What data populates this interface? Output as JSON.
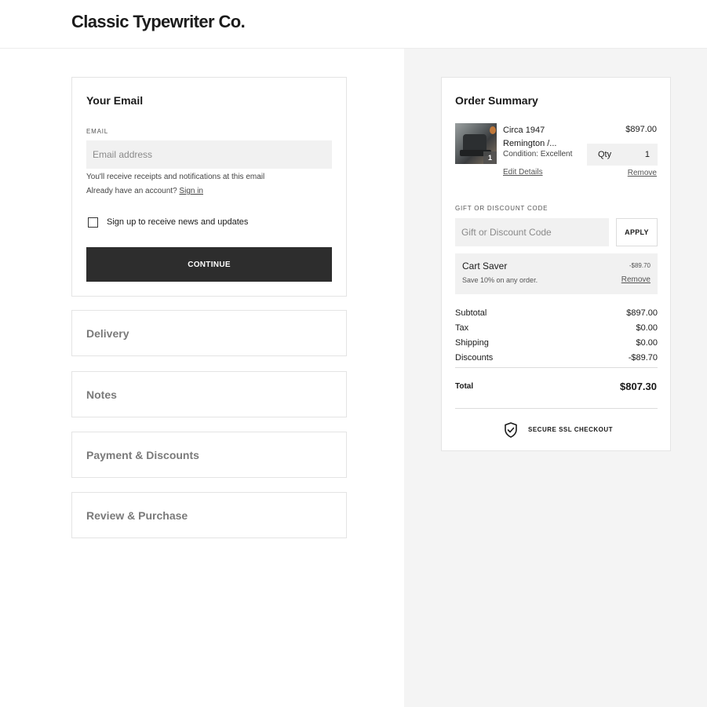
{
  "header": {
    "brand": "Classic Typewriter Co."
  },
  "email_section": {
    "title": "Your Email",
    "field_label": "EMAIL",
    "placeholder": "Email address",
    "value": "",
    "hint": "You'll receive receipts and notifications at this email",
    "account_prompt": "Already have an account?",
    "sign_in_link": "Sign in",
    "newsletter_label": "Sign up to receive news and updates",
    "newsletter_checked": false,
    "continue_label": "CONTINUE"
  },
  "steps": [
    {
      "label": "Delivery"
    },
    {
      "label": "Notes"
    },
    {
      "label": "Payment & Discounts"
    },
    {
      "label": "Review & Purchase"
    }
  ],
  "summary": {
    "title": "Order Summary",
    "item": {
      "name": "Circa 1947 Remington /...",
      "condition": "Condition: Excellent",
      "price": "$897.00",
      "qty_label": "Qty",
      "qty": "1",
      "thumb_badge": "1",
      "edit_link": "Edit Details",
      "remove_link": "Remove"
    },
    "discount": {
      "label": "GIFT OR DISCOUNT CODE",
      "placeholder": "Gift or Discount Code",
      "apply_label": "APPLY"
    },
    "coupon": {
      "name": "Cart Saver",
      "amount": "-$89.70",
      "description": "Save 10% on any order.",
      "remove_link": "Remove"
    },
    "totals": [
      {
        "label": "Subtotal",
        "value": "$897.00"
      },
      {
        "label": "Tax",
        "value": "$0.00"
      },
      {
        "label": "Shipping",
        "value": "$0.00"
      },
      {
        "label": "Discounts",
        "value": "-$89.70"
      }
    ],
    "total_label": "Total",
    "total_value": "$807.30",
    "secure_text": "SECURE SSL CHECKOUT",
    "secure_icon": "shield-check-icon"
  }
}
